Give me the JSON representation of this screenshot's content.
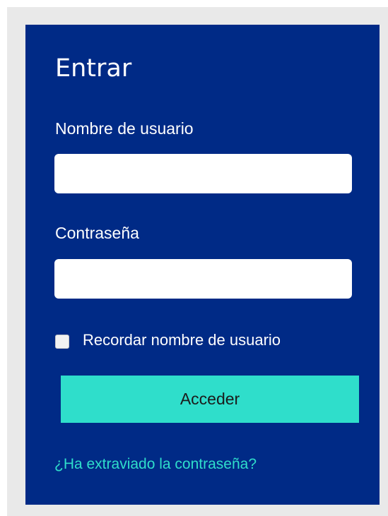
{
  "login": {
    "title": "Entrar",
    "username_label": "Nombre de usuario",
    "username_value": "",
    "password_label": "Contraseña",
    "password_value": "",
    "remember_label": "Recordar nombre de usuario",
    "remember_checked": false,
    "submit_label": "Acceder",
    "forgot_link": "¿Ha extraviado la contraseña?"
  },
  "colors": {
    "panel_bg": "#002a86",
    "accent": "#2fdecb",
    "frame_bg": "#e9e9e9"
  }
}
